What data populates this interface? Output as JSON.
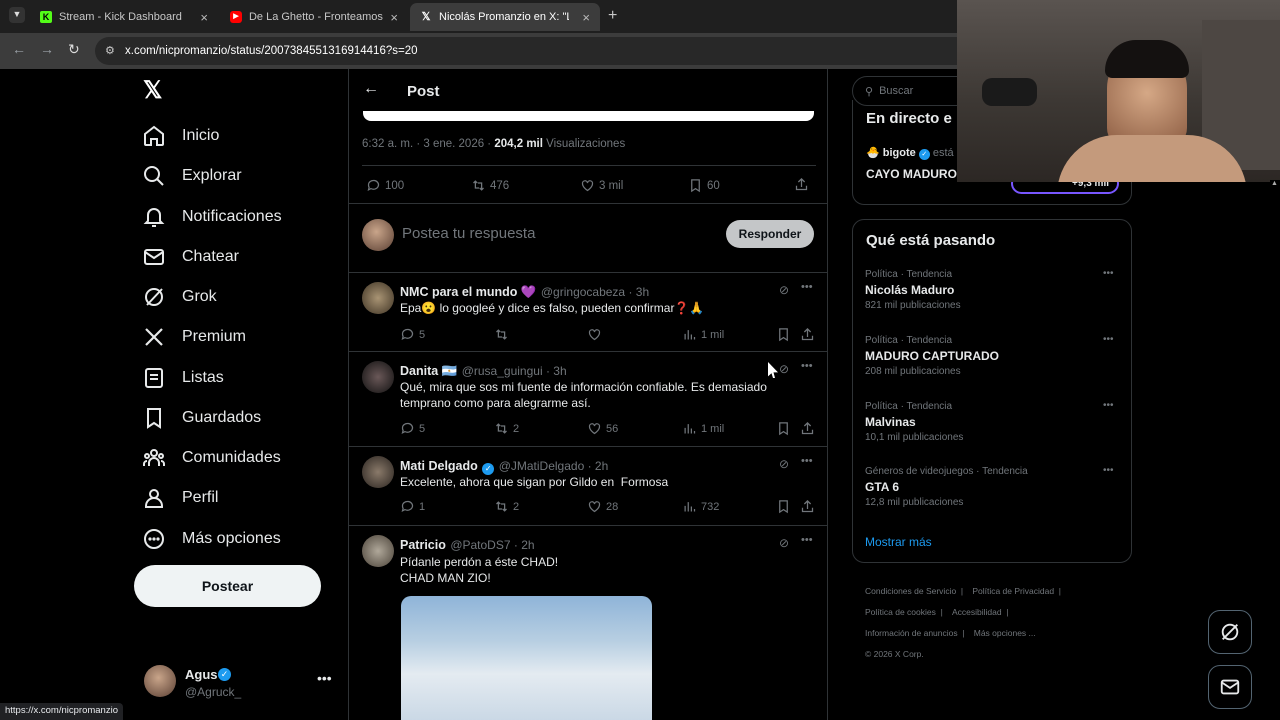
{
  "browser": {
    "tabs": [
      {
        "title": "Stream - Kick Dashboard",
        "icon": "kick-icon"
      },
      {
        "title": "De La Ghetto - Fronteamos Porq",
        "icon": "youtube-icon"
      },
      {
        "title": "Nicolás Promanzio en X: \"LAS F",
        "icon": "x-icon"
      }
    ],
    "url": "x.com/nicpromanzio/status/2007384551316914416?s=20",
    "status_url": "https://x.com/nicpromanzio"
  },
  "nav": {
    "items": [
      {
        "label": "Inicio"
      },
      {
        "label": "Explorar"
      },
      {
        "label": "Notificaciones"
      },
      {
        "label": "Chatear"
      },
      {
        "label": "Grok"
      },
      {
        "label": "Premium"
      },
      {
        "label": "Listas"
      },
      {
        "label": "Guardados"
      },
      {
        "label": "Comunidades"
      },
      {
        "label": "Perfil"
      },
      {
        "label": "Más opciones"
      }
    ],
    "post_button": "Postear",
    "account": {
      "name": "Agus",
      "handle": "@Agruck_"
    }
  },
  "post": {
    "header": "Post",
    "timestamp": "6:32 a. m. · 3 ene. 2026 ·",
    "views": "204,2 mil",
    "views_label": "Visualizaciones",
    "stats": {
      "replies": "100",
      "reposts": "476",
      "likes": "3 mil",
      "bookmarks": "60"
    },
    "reply_placeholder": "Postea tu respuesta",
    "reply_button": "Responder"
  },
  "replies": [
    {
      "name": "NMC para el mundo 💜",
      "handle": "@gringocabeza · 3h",
      "text": "Epa😮 lo googleé y dice es falso, pueden confirmar❓🙏",
      "replies": "5",
      "reposts": "",
      "likes": "",
      "views": "1 mil"
    },
    {
      "name": "Danita 🇦🇷",
      "handle": "@rusa_guingui · 3h",
      "text": "Qué, mira que sos mi fuente de información confiable. Es demasiado temprano como para alegrarme así.",
      "replies": "5",
      "reposts": "2",
      "likes": "56",
      "views": "1 mil"
    },
    {
      "name": "Mati Delgado",
      "handle": "@JMatiDelgado · 2h",
      "text": "Excelente, ahora que sigan por Gildo en  Formosa",
      "replies": "1",
      "reposts": "2",
      "likes": "28",
      "views": "732"
    },
    {
      "name": "Patricio",
      "handle": "@PatoDS7 · 2h",
      "text": "Pídanle perdón a éste CHAD!\nCHAD MAN ZIO!"
    }
  ],
  "sidebar": {
    "search_placeholder": "Buscar",
    "live": {
      "title": "En directo e",
      "user": "🐣 bigote",
      "user_suffix": "está e",
      "text": "CAYO MADURO",
      "count": "+9,3 mil"
    },
    "trends_title": "Qué está pasando",
    "trends": [
      {
        "category": "Política · Tendencia",
        "name": "Nicolás Maduro",
        "count": "821 mil publicaciones"
      },
      {
        "category": "Política · Tendencia",
        "name": "MADURO CAPTURADO",
        "count": "208 mil publicaciones"
      },
      {
        "category": "Política · Tendencia",
        "name": "Malvinas",
        "count": "10,1 mil publicaciones"
      },
      {
        "category": "Géneros de videojuegos · Tendencia",
        "name": "GTA 6",
        "count": "12,8 mil publicaciones"
      }
    ],
    "show_more": "Mostrar más",
    "footer": [
      "Condiciones de Servicio",
      "Política de Privacidad",
      "Política de cookies",
      "Accesibilidad",
      "Información de anuncios",
      "Más opciones ...",
      "© 2026 X Corp."
    ]
  },
  "colors": {
    "accent": "#1d9bf0",
    "bg": "#000000",
    "border": "#2f3336",
    "muted": "#71767b"
  }
}
